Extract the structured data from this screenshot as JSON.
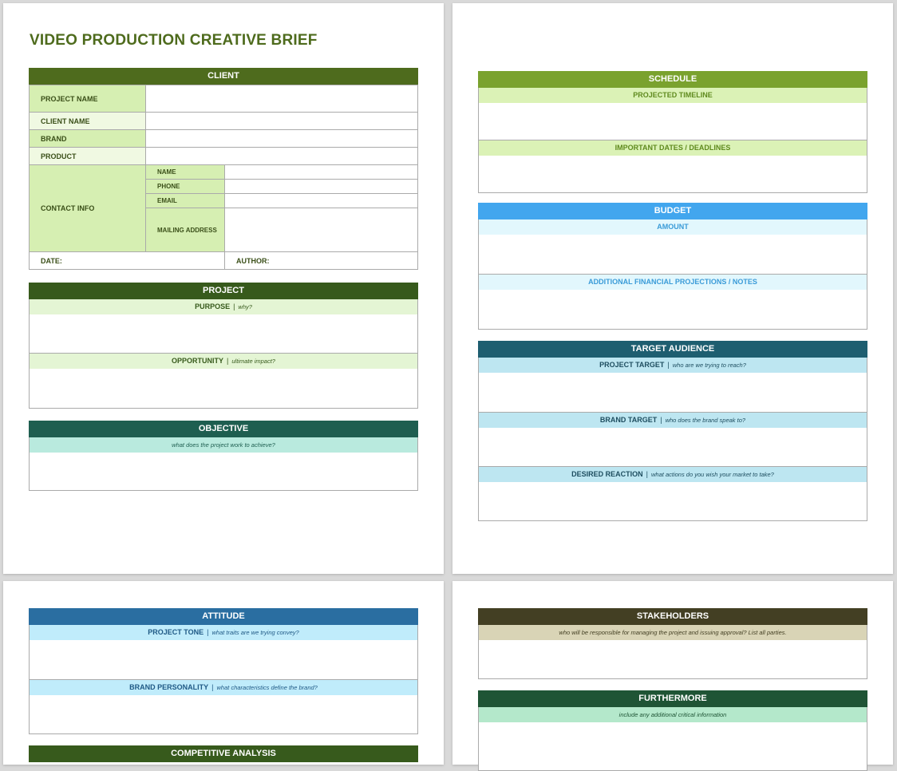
{
  "title": "VIDEO PRODUCTION CREATIVE BRIEF",
  "client": {
    "header": "CLIENT",
    "project_name": "PROJECT NAME",
    "client_name": "CLIENT NAME",
    "brand": "BRAND",
    "product": "PRODUCT",
    "contact_info": "CONTACT INFO",
    "name": "NAME",
    "phone": "PHONE",
    "email": "EMAIL",
    "mailing_address": "MAILING ADDRESS",
    "date": "DATE:",
    "author": "AUTHOR:"
  },
  "project": {
    "header": "PROJECT",
    "purpose": "PURPOSE",
    "purpose_hint": "why?",
    "opportunity": "OPPORTUNITY",
    "opportunity_hint": "ultimate impact?"
  },
  "objective": {
    "header": "OBJECTIVE",
    "hint": "what does the project work to achieve?"
  },
  "schedule": {
    "header": "SCHEDULE",
    "timeline": "PROJECTED TIMELINE",
    "dates": "IMPORTANT DATES / DEADLINES"
  },
  "budget": {
    "header": "BUDGET",
    "amount": "AMOUNT",
    "notes": "ADDITIONAL FINANCIAL PROJECTIONS / NOTES"
  },
  "audience": {
    "header": "TARGET AUDIENCE",
    "project_target": "PROJECT TARGET",
    "project_target_hint": "who are we trying to reach?",
    "brand_target": "BRAND TARGET",
    "brand_target_hint": "who does the brand speak to?",
    "desired_reaction": "DESIRED REACTION",
    "desired_reaction_hint": "what actions do you wish your market to take?"
  },
  "attitude": {
    "header": "ATTITUDE",
    "project_tone": "PROJECT TONE",
    "project_tone_hint": "what traits are we trying convey?",
    "brand_personality": "BRAND PERSONALITY",
    "brand_personality_hint": "what characteristics define the brand?"
  },
  "competitive": {
    "header": "COMPETITIVE ANALYSIS"
  },
  "stakeholders": {
    "header": "STAKEHOLDERS",
    "hint": "who will be responsible for managing the project and issuing approval? List all parties."
  },
  "furthermore": {
    "header": "FURTHERMORE",
    "hint": "include any additional critical information"
  },
  "separator": "|",
  "colors": {
    "client": "#4e6b1d",
    "project": "#375a1c",
    "objective": "#1e5e50",
    "schedule": "#7aa22e",
    "budget": "#42a6ee",
    "audience": "#1e5e70",
    "attitude": "#2a6ea1",
    "stakeholders": "#433f23",
    "furthermore": "#1f5435"
  }
}
